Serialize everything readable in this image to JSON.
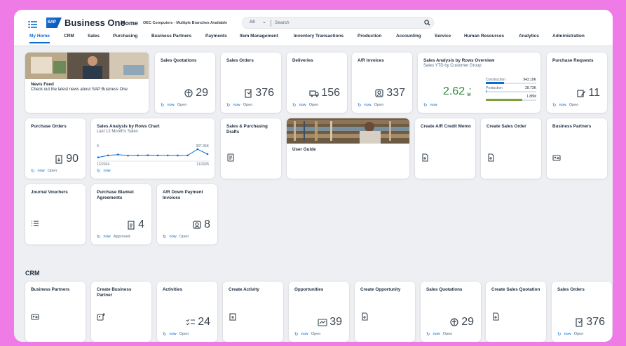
{
  "header": {
    "logo_text": "SAP",
    "app_name": "Business One",
    "home_label": "Home",
    "company": "OEC Computers - Multiple Branches Available",
    "search_scope": "All",
    "search_placeholder": "Search"
  },
  "tabs": [
    "My Home",
    "CRM",
    "Sales",
    "Purchasing",
    "Business Partners",
    "Payments",
    "Item Management",
    "Inventory Transactions",
    "Production",
    "Accounting",
    "Service",
    "Human Resources",
    "Analytics",
    "Administration"
  ],
  "tiles": {
    "news": {
      "title": "News Feed",
      "subtitle": "Check out the latest news about SAP Business One"
    },
    "sales_quotations": {
      "title": "Sales Quotations",
      "value": "29",
      "refresh": "now",
      "status": "Open"
    },
    "sales_orders": {
      "title": "Sales Orders",
      "value": "376",
      "refresh": "now",
      "status": "Open"
    },
    "deliveries": {
      "title": "Deliveries",
      "value": "156",
      "refresh": "now",
      "status": "Open"
    },
    "ar_invoices": {
      "title": "A/R Invoices",
      "value": "337",
      "refresh": "now",
      "status": "Open"
    },
    "sales_analysis": {
      "title": "Sales Analysis by Rows Overview",
      "subtitle": "Sales YTD by Customer Group",
      "value": "2.62",
      "unit": "M",
      "refresh": "now",
      "bars": [
        {
          "label": "Construction",
          "value": "943.18K",
          "fraction": 0.36,
          "color": "#0a6ed1"
        },
        {
          "label": "Production",
          "value": "28.73K",
          "fraction": 0.02,
          "color": "#0a6ed1"
        },
        {
          "label": "",
          "value": "1.88M",
          "fraction": 0.72,
          "color": "#7da13c"
        }
      ]
    },
    "purchase_requests": {
      "title": "Purchase Requests",
      "value": "11",
      "refresh": "now",
      "status": "Open"
    },
    "purchase_orders": {
      "title": "Purchase Orders",
      "value": "90",
      "refresh": "now",
      "status": "Open"
    },
    "sales_chart": {
      "title": "Sales Analysis by Rows Chart",
      "subtitle": "Last 12 Month's Sales",
      "y_min_label": "0",
      "y_max_label": "337.36K",
      "x_start_label": "12/2024",
      "x_end_label": "11/2025",
      "refresh": "now"
    },
    "sp_drafts": {
      "title": "Sales & Purchasing Drafts"
    },
    "user_guide": {
      "title": "User Guide"
    },
    "create_ar_credit": {
      "title": "Create A/R Credit Memo"
    },
    "create_sales_order": {
      "title": "Create Sales Order"
    },
    "business_partners": {
      "title": "Business Partners"
    },
    "journal_vouchers": {
      "title": "Journal Vouchers"
    },
    "purchase_blanket": {
      "title": "Purchase Blanket Agreements",
      "value": "4",
      "refresh": "now",
      "status": "Approved"
    },
    "ar_down_payment": {
      "title": "A/R Down Payment Invoices",
      "value": "8",
      "refresh": "now",
      "status": "Open"
    }
  },
  "crm": {
    "section_title": "CRM",
    "business_partners": {
      "title": "Business Partners"
    },
    "create_business_partner": {
      "title": "Create Business Partner"
    },
    "activities": {
      "title": "Activities",
      "value": "24",
      "refresh": "now",
      "status": "Open"
    },
    "create_activity": {
      "title": "Create Activity"
    },
    "opportunities": {
      "title": "Opportunities",
      "value": "39",
      "refresh": "now",
      "status": "Open"
    },
    "create_opportunity": {
      "title": "Create Opportunity"
    },
    "sales_quotations": {
      "title": "Sales Quotations",
      "value": "29",
      "refresh": "now",
      "status": "Open"
    },
    "create_sales_quotation": {
      "title": "Create Sales Quotation"
    },
    "sales_orders": {
      "title": "Sales Orders",
      "value": "376",
      "refresh": "now",
      "status": "Open"
    }
  },
  "chart_data": {
    "type": "line",
    "x": [
      "12/2024",
      "01/2025",
      "02/2025",
      "03/2025",
      "04/2025",
      "05/2025",
      "06/2025",
      "07/2025",
      "08/2025",
      "09/2025",
      "10/2025",
      "11/2025"
    ],
    "values": [
      90,
      150,
      175,
      145,
      150,
      155,
      150,
      150,
      148,
      150,
      337,
      190
    ],
    "ylim": [
      0,
      337.36
    ],
    "color": "#0a6ed1"
  }
}
